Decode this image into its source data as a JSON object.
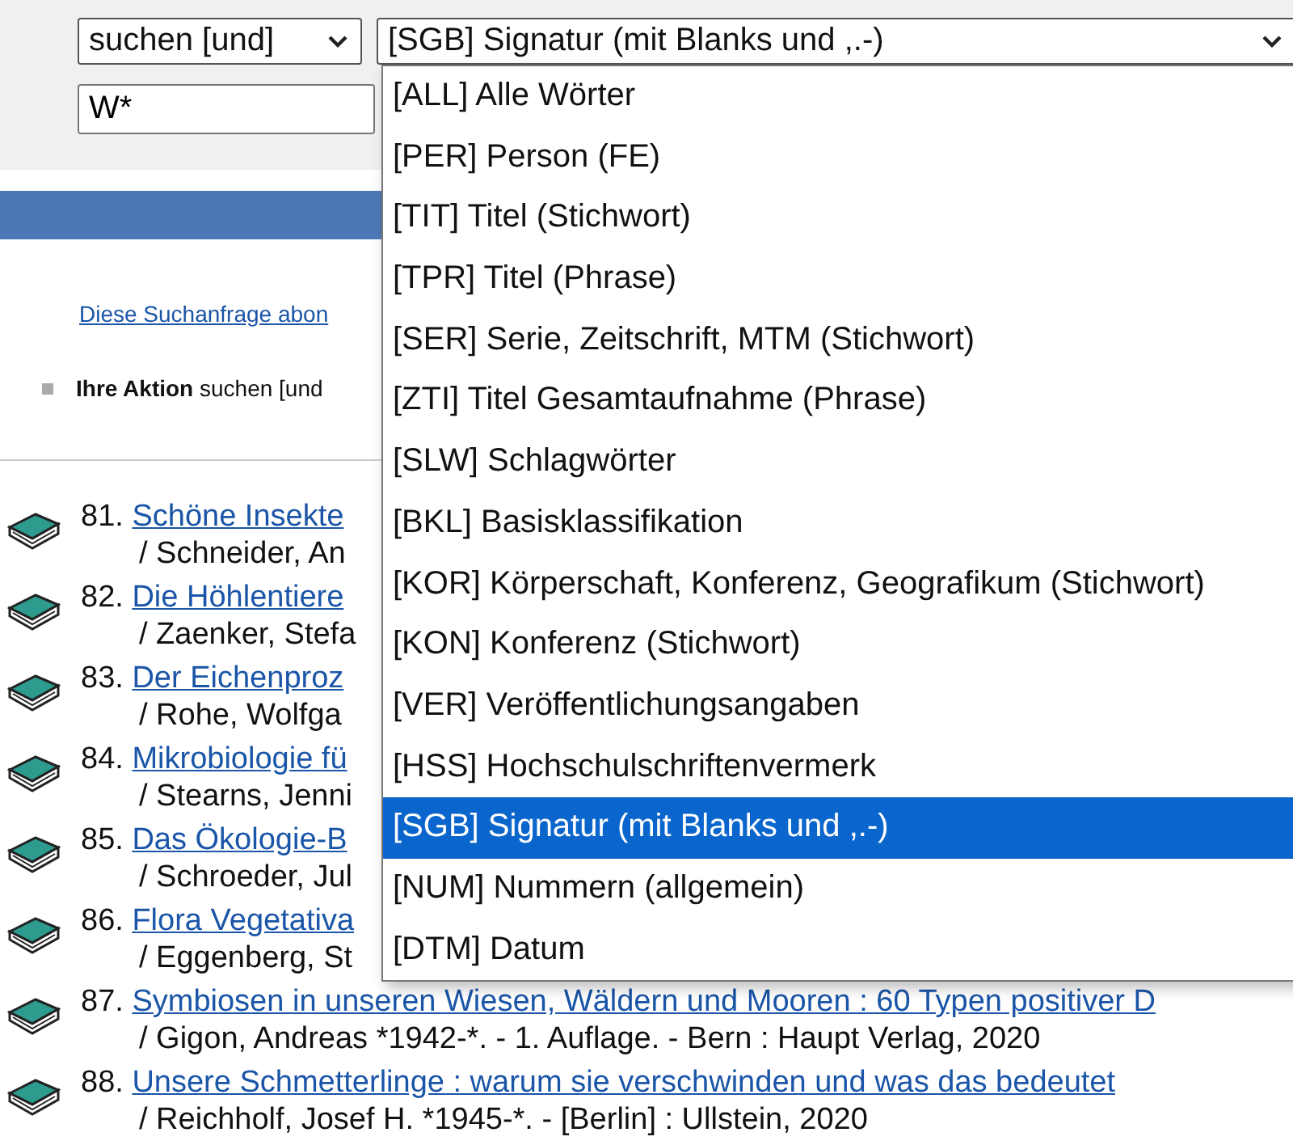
{
  "search": {
    "mode_select": "suchen [und]",
    "field_select": "[SGB] Signatur (mit Blanks und ,.-)",
    "query": "W*"
  },
  "dropdown": {
    "options": [
      {
        "label": "[ALL] Alle Wörter",
        "selected": false
      },
      {
        "label": "[PER] Person (FE)",
        "selected": false
      },
      {
        "label": "[TIT] Titel (Stichwort)",
        "selected": false
      },
      {
        "label": "[TPR] Titel (Phrase)",
        "selected": false
      },
      {
        "label": "[SER] Serie, Zeitschrift, MTM (Stichwort)",
        "selected": false
      },
      {
        "label": "[ZTI] Titel Gesamtaufnahme (Phrase)",
        "selected": false
      },
      {
        "label": "[SLW] Schlagwörter",
        "selected": false
      },
      {
        "label": "[BKL] Basisklassifikation",
        "selected": false
      },
      {
        "label": "[KOR] Körperschaft, Konferenz, Geografikum (Stichwort)",
        "selected": false
      },
      {
        "label": "[KON] Konferenz (Stichwort)",
        "selected": false
      },
      {
        "label": "[VER] Veröffentlichungsangaben",
        "selected": false
      },
      {
        "label": "[HSS] Hochschulschriftenvermerk",
        "selected": false
      },
      {
        "label": "[SGB] Signatur (mit Blanks und ,.-)",
        "selected": true
      },
      {
        "label": "[NUM] Nummern (allgemein)",
        "selected": false
      },
      {
        "label": "[DTM] Datum",
        "selected": false
      }
    ]
  },
  "subscribe_link": "Diese Suchanfrage abon",
  "action": {
    "label": "Ihre Aktion",
    "text": "suchen [und"
  },
  "results": [
    {
      "number": "81.",
      "title": "Schöne Insekte",
      "details": "/ Schneider, An"
    },
    {
      "number": "82.",
      "title": "Die Höhlentiere",
      "details": "/ Zaenker, Stefa"
    },
    {
      "number": "83.",
      "title": "Der Eichenproz",
      "details": "/ Rohe, Wolfga"
    },
    {
      "number": "84.",
      "title": "Mikrobiologie fü",
      "details": "/ Stearns, Jenni"
    },
    {
      "number": "85.",
      "title": "Das Ökologie-B",
      "details": "/ Schroeder, Jul"
    },
    {
      "number": "86.",
      "title": "Flora Vegetativa",
      "details": "/ Eggenberg, St"
    },
    {
      "number": "87.",
      "title": "Symbiosen in unseren Wiesen, Wäldern und Mooren : 60 Typen positiver D",
      "details": "/ Gigon, Andreas *1942-*. - 1. Auflage. - Bern : Haupt Verlag, 2020"
    },
    {
      "number": "88.",
      "title": "Unsere Schmetterlinge : warum sie verschwinden und was das bedeutet",
      "details": "/ Reichholf, Josef H. *1945-*. - [Berlin] : Ullstein, 2020"
    }
  ]
}
